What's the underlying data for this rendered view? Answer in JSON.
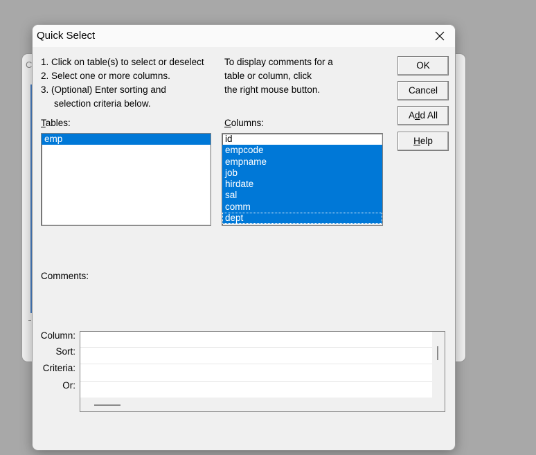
{
  "background": {
    "window_letter": "C"
  },
  "dialog": {
    "title": "Quick Select",
    "instructions": [
      "1. Click on table(s) to select or deselect",
      "2. Select one or more columns.",
      "3. (Optional) Enter sorting and",
      "selection criteria below."
    ],
    "hint": [
      "To display comments for a",
      "table or column, click",
      "the right mouse button."
    ],
    "tables_label_first": "T",
    "tables_label_rest": "ables:",
    "columns_label_first": "C",
    "columns_label_rest": "olumns:",
    "comments_label": "Comments:",
    "tables": [
      {
        "name": "emp",
        "selected": true
      }
    ],
    "columns": [
      {
        "name": "id",
        "selected": false
      },
      {
        "name": "empcode",
        "selected": true
      },
      {
        "name": "empname",
        "selected": true
      },
      {
        "name": "job",
        "selected": true
      },
      {
        "name": "hirdate",
        "selected": true
      },
      {
        "name": "sal",
        "selected": true
      },
      {
        "name": "comm",
        "selected": true
      },
      {
        "name": "dept",
        "selected": true
      }
    ],
    "buttons": {
      "ok": "OK",
      "cancel": "Cancel",
      "add_all_pre": "A",
      "add_all_u": "d",
      "add_all_post": "d All",
      "help_u": "H",
      "help_post": "elp"
    },
    "grid_labels": {
      "column": "Column:",
      "sort": "Sort:",
      "criteria": "Criteria:",
      "or": "Or:"
    }
  },
  "colors": {
    "selection": "#0078d7",
    "dialog_bg": "#f0f0f0",
    "backdrop": "#a8a8a8"
  }
}
